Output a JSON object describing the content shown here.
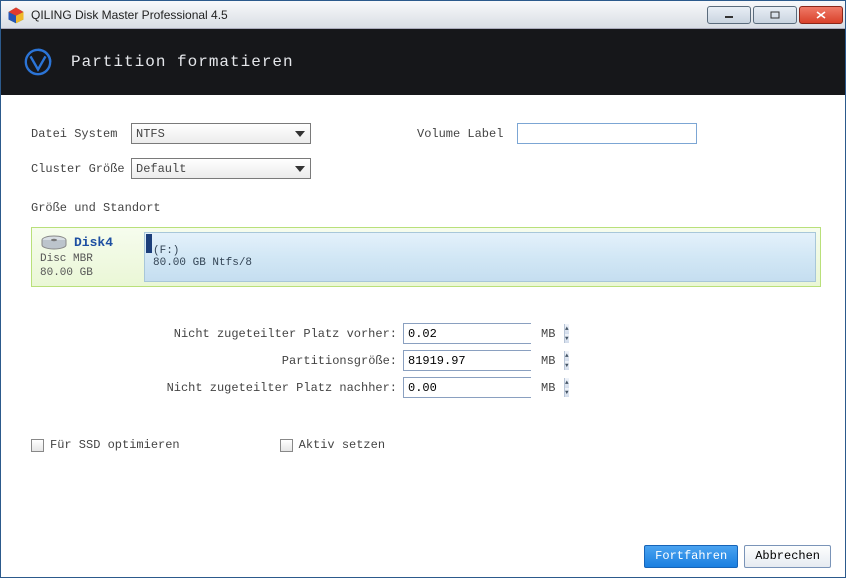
{
  "window": {
    "title": "QILING Disk Master Professional 4.5"
  },
  "header": {
    "headline": "Partition formatieren"
  },
  "form": {
    "file_system_label": "Datei System",
    "file_system_value": "NTFS",
    "cluster_label": "Cluster Größe",
    "cluster_value": "Default",
    "volume_label_label": "Volume Label",
    "volume_label_value": ""
  },
  "size_section": {
    "heading": "Größe und Standort",
    "unalloc_before_label": "Nicht zugeteilter Platz vorher:",
    "unalloc_before_value": "0.02",
    "partition_size_label": "Partitionsgröße:",
    "partition_size_value": "81919.97",
    "unalloc_after_label": "Nicht zugeteilter Platz nachher:",
    "unalloc_after_value": "0.00",
    "unit": "MB"
  },
  "disk": {
    "name": "Disk4",
    "type": "Disc MBR",
    "capacity": "80.00 GB",
    "partition_drive": "(F:)",
    "partition_desc": "80.00 GB Ntfs/8"
  },
  "options": {
    "ssd_label": "Für SSD optimieren",
    "active_label": "Aktiv setzen"
  },
  "buttons": {
    "continue": "Fortfahren",
    "cancel": "Abbrechen"
  }
}
